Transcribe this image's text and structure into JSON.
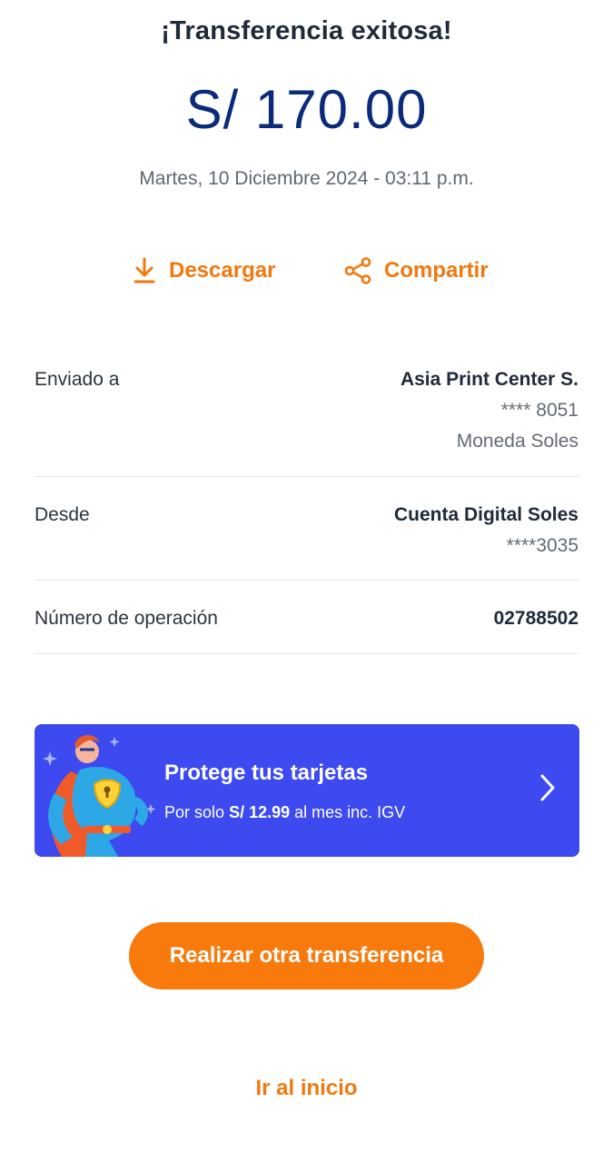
{
  "header": {
    "title": "¡Transferencia exitosa!",
    "amount": "S/ 170.00",
    "datetime": "Martes, 10 Diciembre 2024 - 03:11 p.m."
  },
  "actions": {
    "download_label": "Descargar",
    "download_icon": "download-icon",
    "share_label": "Compartir",
    "share_icon": "share-icon"
  },
  "details": {
    "sent_to": {
      "label": "Enviado a",
      "name": "Asia Print Center S.",
      "account": "**** 8051",
      "currency": "Moneda Soles"
    },
    "from": {
      "label": "Desde",
      "name": "Cuenta Digital Soles",
      "account": "****3035"
    },
    "operation": {
      "label": "Número de operación",
      "value": "02788502"
    }
  },
  "promo": {
    "title": "Protege tus tarjetas",
    "sub_prefix": "Por solo",
    "price": "S/ 12.99",
    "sub_suffix": "al mes inc. IGV",
    "background_color": "#3c4aef"
  },
  "cta": {
    "label": "Realizar otra transferencia",
    "color": "#f87a0c"
  },
  "footer": {
    "home_label": "Ir al inicio"
  }
}
